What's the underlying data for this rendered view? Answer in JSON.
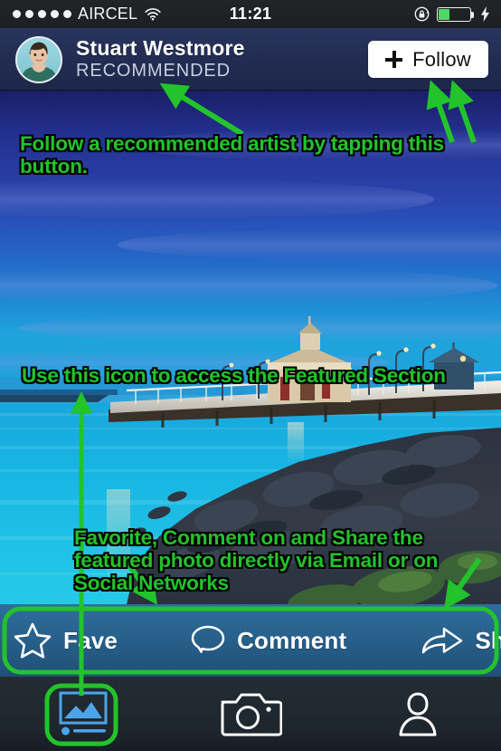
{
  "status_bar": {
    "signal_dots": 5,
    "carrier": "AIRCEL",
    "wifi_icon": "wifi-icon",
    "time": "11:21",
    "rotation_lock_icon": "rotation-lock-icon",
    "battery_icon": "battery-icon",
    "battery_level_pct": 33,
    "charging_icon": "lightning-bolt-icon"
  },
  "header": {
    "avatar_icon": "user-avatar-photo",
    "artist_name": "Stuart Westmore",
    "artist_status": "RECOMMENDED",
    "follow_button": {
      "label": "Follow",
      "plus_icon": "plus-icon"
    }
  },
  "photo": {
    "description": "featured-photo-pier-at-dusk"
  },
  "action_bar": {
    "items": [
      {
        "icon": "star-outline-icon",
        "label": "Fave"
      },
      {
        "icon": "speech-bubble-icon",
        "label": "Comment"
      },
      {
        "icon": "share-arrow-icon",
        "label": "Share"
      }
    ]
  },
  "tab_bar": {
    "tabs": [
      {
        "icon": "gallery-photo-icon",
        "name": "featured",
        "selected": true
      },
      {
        "icon": "camera-icon",
        "name": "camera",
        "selected": false
      },
      {
        "icon": "person-icon",
        "name": "profile",
        "selected": false
      }
    ]
  },
  "annotations": {
    "accent_color": "#22c32b",
    "outline_color": "#000000",
    "follow_text": "Follow a recommended artist by tapping this button.",
    "featured_text": "Use this icon to access the Featured Section",
    "social_text": "Favorite, Comment on and Share the featured photo directly via Email or on Social Networks"
  },
  "colors": {
    "status_bar_bg": "#1f2326",
    "header_bg": "#232d53",
    "action_bar_bg": "#28618c",
    "tab_bar_bg": "#1e262e",
    "follow_button_bg": "#ffffff",
    "selected_tab_icon": "#4ea4e8",
    "annotation_green": "#22c32b"
  }
}
